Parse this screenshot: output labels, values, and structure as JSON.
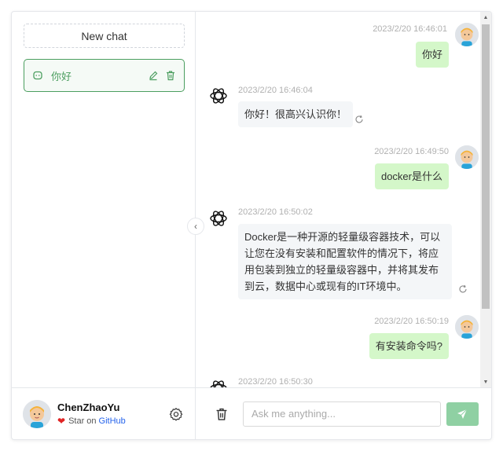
{
  "sidebar": {
    "new_chat_label": "New chat",
    "conversations": [
      {
        "title": "你好"
      }
    ],
    "user": {
      "name": "ChenZhaoYu",
      "star_text": "Star on",
      "github_link": "GitHub"
    }
  },
  "messages": [
    {
      "role": "user",
      "time": "2023/2/20 16:46:01",
      "text": "你好"
    },
    {
      "role": "assistant",
      "time": "2023/2/20 16:46:04",
      "text": "你好！很高兴认识你！"
    },
    {
      "role": "user",
      "time": "2023/2/20 16:49:50",
      "text": "docker是什么"
    },
    {
      "role": "assistant",
      "time": "2023/2/20 16:50:02",
      "text": "Docker是一种开源的轻量级容器技术，可以让您在没有安装和配置软件的情况下，将应用包装到独立的轻量级容器中，并将其发布到云，数据中心或现有的IT环境中。"
    },
    {
      "role": "user",
      "time": "2023/2/20 16:50:19",
      "text": "有安装命令吗?"
    },
    {
      "role": "assistant",
      "time": "2023/2/20 16:50:30",
      "text": ""
    }
  ],
  "input": {
    "placeholder": "Ask me anything..."
  },
  "colors": {
    "accent": "#4b9e5f",
    "user_bubble": "#d4f7c9",
    "bot_bubble": "#f4f6f8",
    "send_button": "#8fd0a3",
    "heart": "#e02424",
    "link": "#2563eb"
  },
  "icons": {
    "conversation": "chat-bubble-icon",
    "edit": "pencil-icon",
    "delete": "trash-icon",
    "settings": "gear-icon",
    "collapse": "chevron-left-icon",
    "clear": "trash-icon",
    "send": "paper-plane-icon",
    "regenerate": "refresh-icon",
    "bot_avatar": "openai-logo-icon"
  }
}
